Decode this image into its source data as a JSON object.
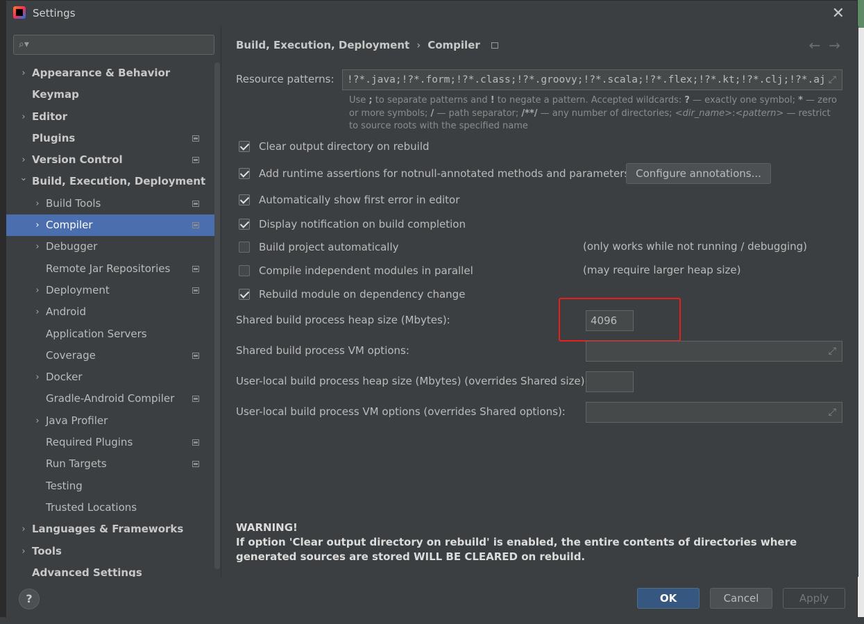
{
  "window": {
    "title": "Settings"
  },
  "sidebar": {
    "search_placeholder": "",
    "items": [
      {
        "label": "Appearance & Behavior",
        "level": 0,
        "arrow": true,
        "bold": true,
        "proj": false,
        "name": "sidebar-item-appearance-behavior"
      },
      {
        "label": "Keymap",
        "level": 0,
        "arrow": false,
        "bold": true,
        "proj": false,
        "name": "sidebar-item-keymap"
      },
      {
        "label": "Editor",
        "level": 0,
        "arrow": true,
        "bold": true,
        "proj": false,
        "name": "sidebar-item-editor"
      },
      {
        "label": "Plugins",
        "level": 0,
        "arrow": false,
        "bold": true,
        "proj": true,
        "name": "sidebar-item-plugins"
      },
      {
        "label": "Version Control",
        "level": 0,
        "arrow": true,
        "bold": true,
        "proj": true,
        "name": "sidebar-item-version-control"
      },
      {
        "label": "Build, Execution, Deployment",
        "level": 0,
        "arrow": true,
        "expanded": true,
        "bold": true,
        "proj": false,
        "name": "sidebar-item-build-execution-deployment"
      },
      {
        "label": "Build Tools",
        "level": 1,
        "arrow": true,
        "bold": false,
        "proj": true,
        "name": "sidebar-item-build-tools"
      },
      {
        "label": "Compiler",
        "level": 1,
        "arrow": true,
        "bold": false,
        "proj": true,
        "selected": true,
        "name": "sidebar-item-compiler"
      },
      {
        "label": "Debugger",
        "level": 1,
        "arrow": true,
        "bold": false,
        "proj": false,
        "name": "sidebar-item-debugger"
      },
      {
        "label": "Remote Jar Repositories",
        "level": 1,
        "arrow": false,
        "bold": false,
        "proj": true,
        "name": "sidebar-item-remote-jar-repositories"
      },
      {
        "label": "Deployment",
        "level": 1,
        "arrow": true,
        "bold": false,
        "proj": true,
        "name": "sidebar-item-deployment"
      },
      {
        "label": "Android",
        "level": 1,
        "arrow": true,
        "bold": false,
        "proj": false,
        "name": "sidebar-item-android"
      },
      {
        "label": "Application Servers",
        "level": 1,
        "arrow": false,
        "bold": false,
        "proj": false,
        "name": "sidebar-item-application-servers"
      },
      {
        "label": "Coverage",
        "level": 1,
        "arrow": false,
        "bold": false,
        "proj": true,
        "name": "sidebar-item-coverage"
      },
      {
        "label": "Docker",
        "level": 1,
        "arrow": true,
        "bold": false,
        "proj": false,
        "name": "sidebar-item-docker"
      },
      {
        "label": "Gradle-Android Compiler",
        "level": 1,
        "arrow": false,
        "bold": false,
        "proj": true,
        "name": "sidebar-item-gradle-android-compiler"
      },
      {
        "label": "Java Profiler",
        "level": 1,
        "arrow": true,
        "bold": false,
        "proj": false,
        "name": "sidebar-item-java-profiler"
      },
      {
        "label": "Required Plugins",
        "level": 1,
        "arrow": false,
        "bold": false,
        "proj": true,
        "name": "sidebar-item-required-plugins"
      },
      {
        "label": "Run Targets",
        "level": 1,
        "arrow": false,
        "bold": false,
        "proj": true,
        "name": "sidebar-item-run-targets"
      },
      {
        "label": "Testing",
        "level": 1,
        "arrow": false,
        "bold": false,
        "proj": false,
        "name": "sidebar-item-testing"
      },
      {
        "label": "Trusted Locations",
        "level": 1,
        "arrow": false,
        "bold": false,
        "proj": false,
        "name": "sidebar-item-trusted-locations"
      },
      {
        "label": "Languages & Frameworks",
        "level": 0,
        "arrow": true,
        "bold": true,
        "proj": false,
        "name": "sidebar-item-languages-frameworks"
      },
      {
        "label": "Tools",
        "level": 0,
        "arrow": true,
        "bold": true,
        "proj": false,
        "name": "sidebar-item-tools"
      },
      {
        "label": "Advanced Settings",
        "level": 0,
        "arrow": false,
        "bold": true,
        "proj": false,
        "name": "sidebar-item-advanced-settings"
      }
    ]
  },
  "breadcrumb": {
    "parent": "Build, Execution, Deployment",
    "separator": "›",
    "current": "Compiler"
  },
  "nav": {
    "back": "←",
    "forward": "→"
  },
  "resource_patterns": {
    "label": "Resource patterns:",
    "value": "!?*.java;!?*.form;!?*.class;!?*.groovy;!?*.scala;!?*.flex;!?*.kt;!?*.clj;!?*.aj"
  },
  "hint": {
    "t1": "Use ",
    "b1": ";",
    "t2": " to separate patterns and ",
    "b2": "!",
    "t3": " to negate a pattern. Accepted wildcards: ",
    "b3": "?",
    "t4": " — exactly one symbol; ",
    "b4": "*",
    "t5": " — zero or more symbols; ",
    "b5": "/",
    "t6": " — path separator; ",
    "b6": "/**/",
    "t7": " — any number of directories; ",
    "i1": "<dir_name>",
    "t8": ":",
    "i2": "<pattern>",
    "t9": " — restrict to source roots with the specified name"
  },
  "options": {
    "clear_output": {
      "label": "Clear output directory on rebuild",
      "checked": true
    },
    "runtime_assertions": {
      "label": "Add runtime assertions for notnull-annotated methods and parameters",
      "checked": true
    },
    "configure_annotations": "Configure annotations...",
    "show_first_error": {
      "label": "Automatically show first error in editor",
      "checked": true
    },
    "display_notification": {
      "label": "Display notification on build completion",
      "checked": true
    },
    "build_automatically": {
      "label": "Build project automatically",
      "checked": false,
      "note": "(only works while not running / debugging)"
    },
    "compile_parallel": {
      "label": "Compile independent modules in parallel",
      "checked": false,
      "note": "(may require larger heap size)"
    },
    "rebuild_on_dependency": {
      "label": "Rebuild module on dependency change",
      "checked": true
    }
  },
  "fields": {
    "shared_heap": {
      "label": "Shared build process heap size (Mbytes):",
      "value": "4096"
    },
    "shared_vm": {
      "label": "Shared build process VM options:",
      "value": ""
    },
    "user_heap": {
      "label": "User-local build process heap size (Mbytes) (overrides Shared size):",
      "value": ""
    },
    "user_vm": {
      "label": "User-local build process VM options (overrides Shared options):",
      "value": ""
    }
  },
  "warning": {
    "title": "WARNING!",
    "text": "If option 'Clear output directory on rebuild' is enabled, the entire contents of directories where generated sources are stored WILL BE CLEARED on rebuild."
  },
  "footer": {
    "help": "?",
    "ok": "OK",
    "cancel": "Cancel",
    "apply": "Apply"
  },
  "colors": {
    "accent": "#4b6eaf",
    "background": "#3c3f41",
    "highlight_box": "#e8201c",
    "primary_button": "#365880"
  }
}
